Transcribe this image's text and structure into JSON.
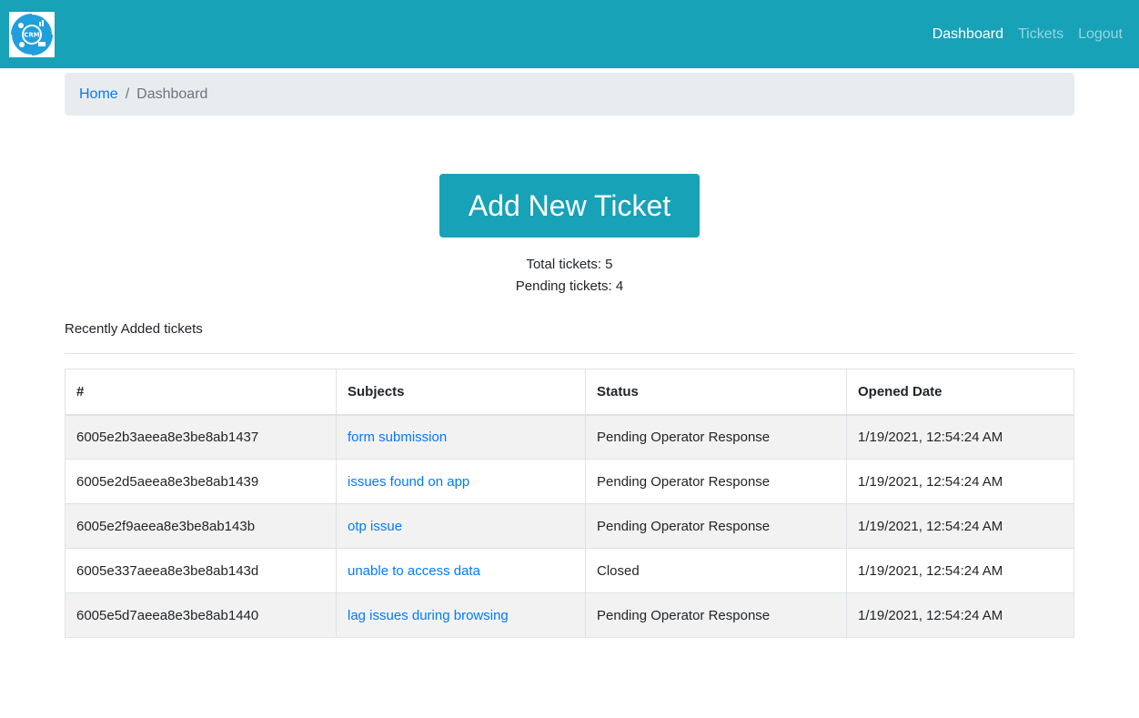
{
  "nav": {
    "links": [
      "Dashboard",
      "Tickets",
      "Logout"
    ],
    "active": "Dashboard",
    "logo_text": "CRM"
  },
  "breadcrumb": {
    "home": "Home",
    "current": "Dashboard"
  },
  "hero": {
    "button_label": "Add New Ticket",
    "total_tickets": "Total tickets: 5",
    "pending_tickets": "Pending tickets: 4"
  },
  "section_title": "Recently Added tickets",
  "table": {
    "headers": [
      "#",
      "Subjects",
      "Status",
      "Opened Date"
    ],
    "rows": [
      {
        "id": "6005e2b3aeea8e3be8ab1437",
        "subject": "form submission",
        "status": "Pending Operator Response",
        "date": "1/19/2021, 12:54:24 AM"
      },
      {
        "id": "6005e2d5aeea8e3be8ab1439",
        "subject": "issues found on app",
        "status": "Pending Operator Response",
        "date": "1/19/2021, 12:54:24 AM"
      },
      {
        "id": "6005e2f9aeea8e3be8ab143b",
        "subject": "otp issue",
        "status": "Pending Operator Response",
        "date": "1/19/2021, 12:54:24 AM"
      },
      {
        "id": "6005e337aeea8e3be8ab143d",
        "subject": "unable to access data",
        "status": "Closed",
        "date": "1/19/2021, 12:54:24 AM"
      },
      {
        "id": "6005e5d7aeea8e3be8ab1440",
        "subject": "lag issues during browsing",
        "status": "Pending Operator Response",
        "date": "1/19/2021, 12:54:24 AM"
      }
    ]
  },
  "colors": {
    "primary": "#17a2b8",
    "link": "#007bff"
  }
}
